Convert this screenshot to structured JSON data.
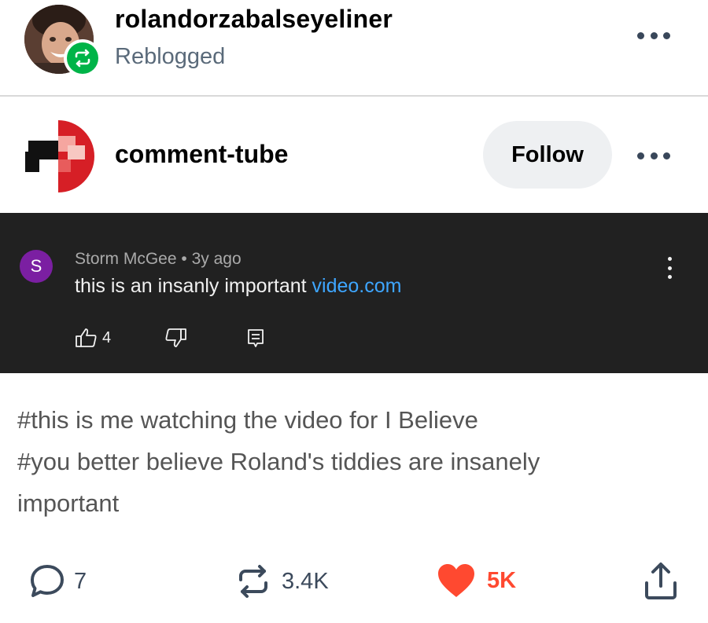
{
  "reblog": {
    "username": "rolandorzabalseyeliner",
    "label": "Reblogged"
  },
  "blog": {
    "name": "comment-tube",
    "follow_label": "Follow"
  },
  "comment": {
    "avatar_letter": "S",
    "avatar_color": "#7b1fa2",
    "author": "Storm McGee",
    "separator": "•",
    "time": "3y ago",
    "text_prefix": "this is an insanly important ",
    "text_link": "video.com",
    "like_count": "4"
  },
  "tags": {
    "line1": "#this is me watching the video for I Believe",
    "line2": "#you better believe Roland's tiddies are insanely",
    "line3": "important"
  },
  "actions": {
    "notes_count": "7",
    "reblogs_count": "3.4K",
    "likes_count": "5K"
  },
  "colors": {
    "reblog_green": "#00b448",
    "like_red": "#ff4930",
    "link_blue": "#3ea6ff",
    "comment_bg": "#212121"
  },
  "icons": [
    "reblog-icon",
    "more-icon",
    "thumbs-up-icon",
    "thumbs-down-icon",
    "reply-icon",
    "comment-bubble-icon",
    "heart-icon",
    "share-icon"
  ]
}
